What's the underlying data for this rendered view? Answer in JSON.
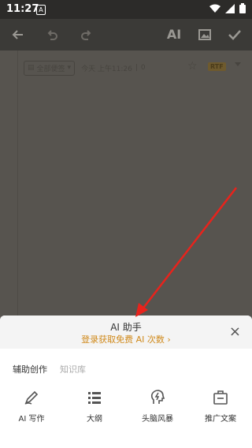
{
  "status_bar": {
    "time": "11:27",
    "notification_icon": "A"
  },
  "app_bar": {
    "icons": [
      "back-arrow-icon",
      "undo-icon",
      "redo-icon",
      "ai-icon",
      "image-icon",
      "check-icon"
    ],
    "ai_label": "AI"
  },
  "editor": {
    "notebook_label": "全部便签",
    "timestamp": "今天 上午11:26",
    "separator": "|",
    "char_count": "0",
    "format_badge": "RTF"
  },
  "assistant_sheet": {
    "title": "AI 助手",
    "subtitle": "登录获取免费 AI 次数",
    "subtitle_chevron": "›",
    "close_icon": "×",
    "tabs": [
      {
        "label": "辅助创作",
        "active": true
      },
      {
        "label": "知识库",
        "active": false
      }
    ],
    "tools": [
      {
        "label": "AI 写作",
        "icon": "pen-icon"
      },
      {
        "label": "大纲",
        "icon": "outline-list-icon"
      },
      {
        "label": "头脑风暴",
        "icon": "brainstorm-icon"
      },
      {
        "label": "推广文案",
        "icon": "promo-copy-icon"
      }
    ]
  },
  "colors": {
    "accent": "#d08a1c",
    "overlay": "#57544f",
    "sheet_bg": "#ffffff",
    "annotation_arrow": "#e8231c"
  }
}
